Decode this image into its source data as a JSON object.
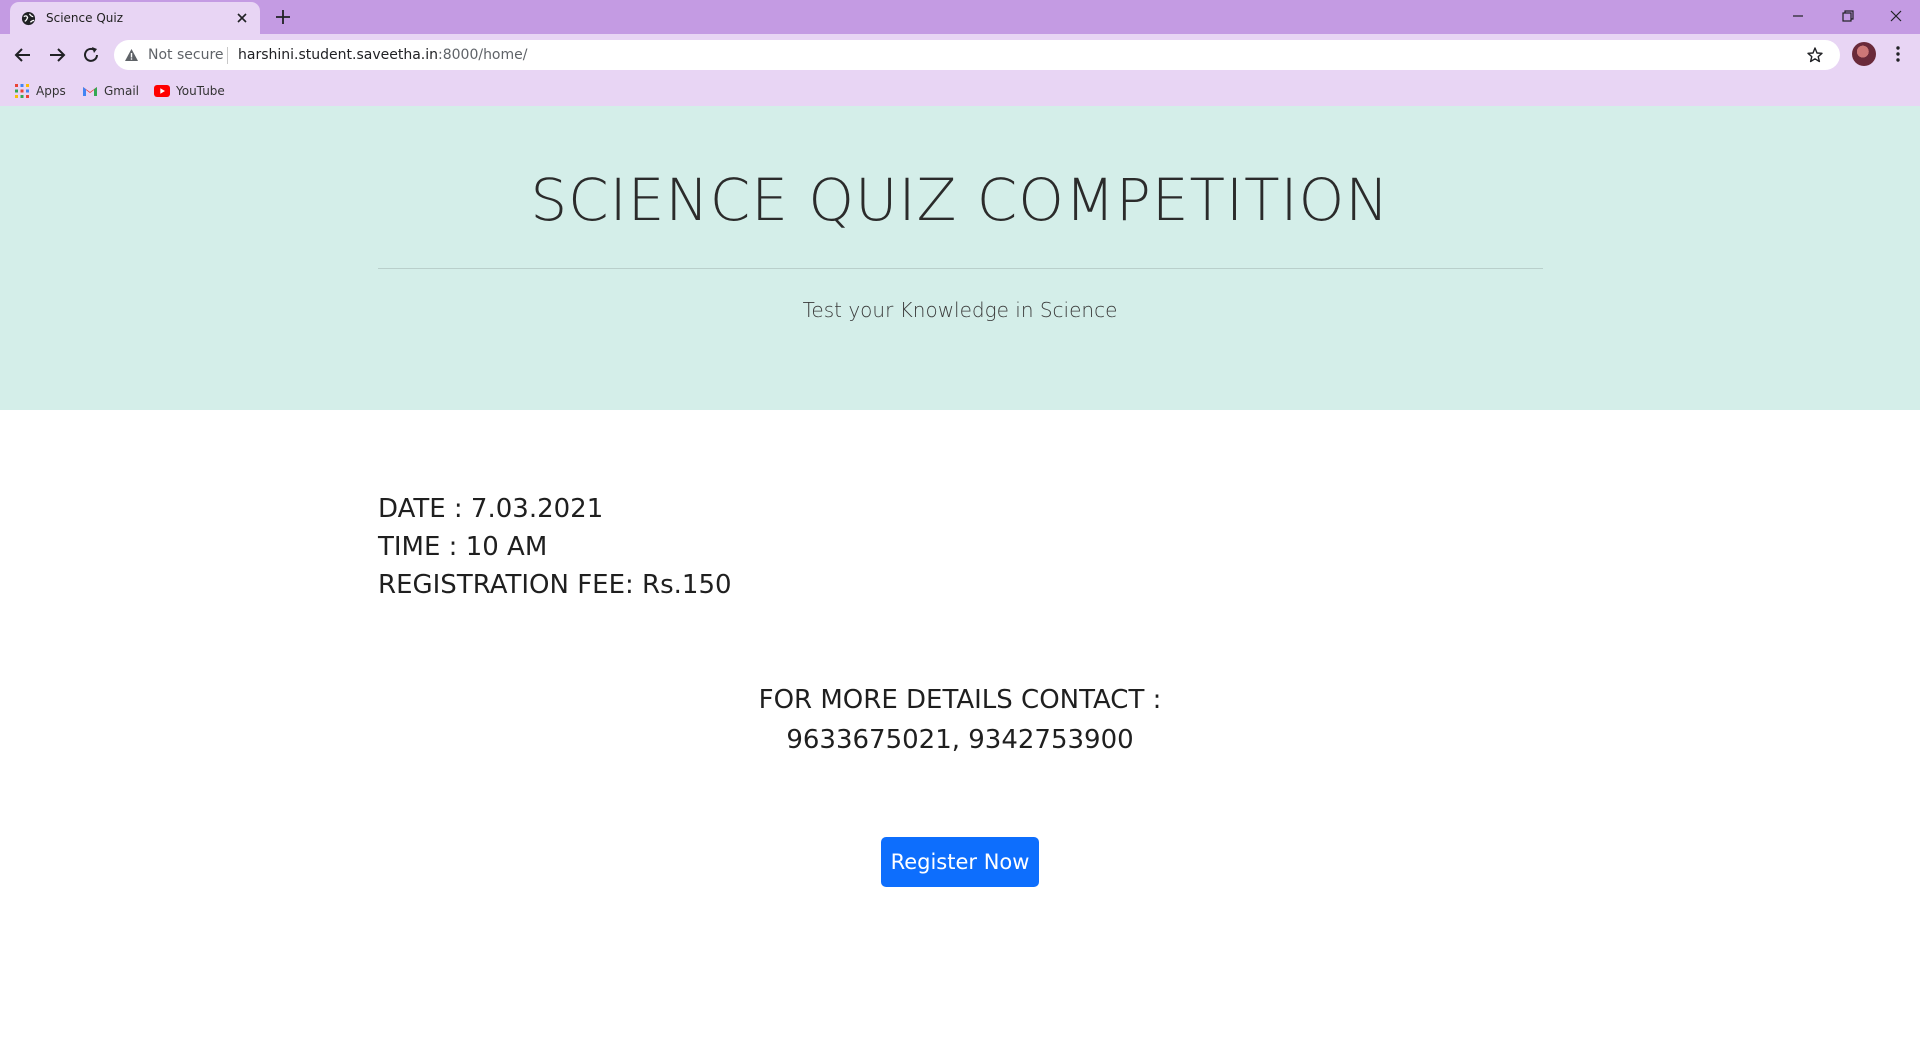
{
  "browser": {
    "tab": {
      "title": "Science Quiz"
    },
    "address": {
      "security_label": "Not secure",
      "url_host": "harshini.student.saveetha.in",
      "url_rest": ":8000/home/"
    },
    "bookmarks": [
      {
        "label": "Apps",
        "icon": "apps-grid-icon"
      },
      {
        "label": "Gmail",
        "icon": "gmail-icon"
      },
      {
        "label": "YouTube",
        "icon": "youtube-icon"
      }
    ],
    "colors": {
      "tabstrip": "#c49be3",
      "toolbar": "#e8d5f4"
    }
  },
  "page": {
    "hero": {
      "title": "SCIENCE QUIZ COMPETITION",
      "subtitle": "Test your Knowledge in Science"
    },
    "info": {
      "date": "DATE : 7.03.2021",
      "time": "TIME : 10 AM",
      "fee": "REGISTRATION FEE: Rs.150"
    },
    "contact": {
      "heading": "FOR MORE DETAILS CONTACT :",
      "numbers": "9633675021, 9342753900"
    },
    "register_label": "Register Now",
    "colors": {
      "hero_bg": "#d4eee9",
      "button_bg": "#0d6efd"
    }
  }
}
